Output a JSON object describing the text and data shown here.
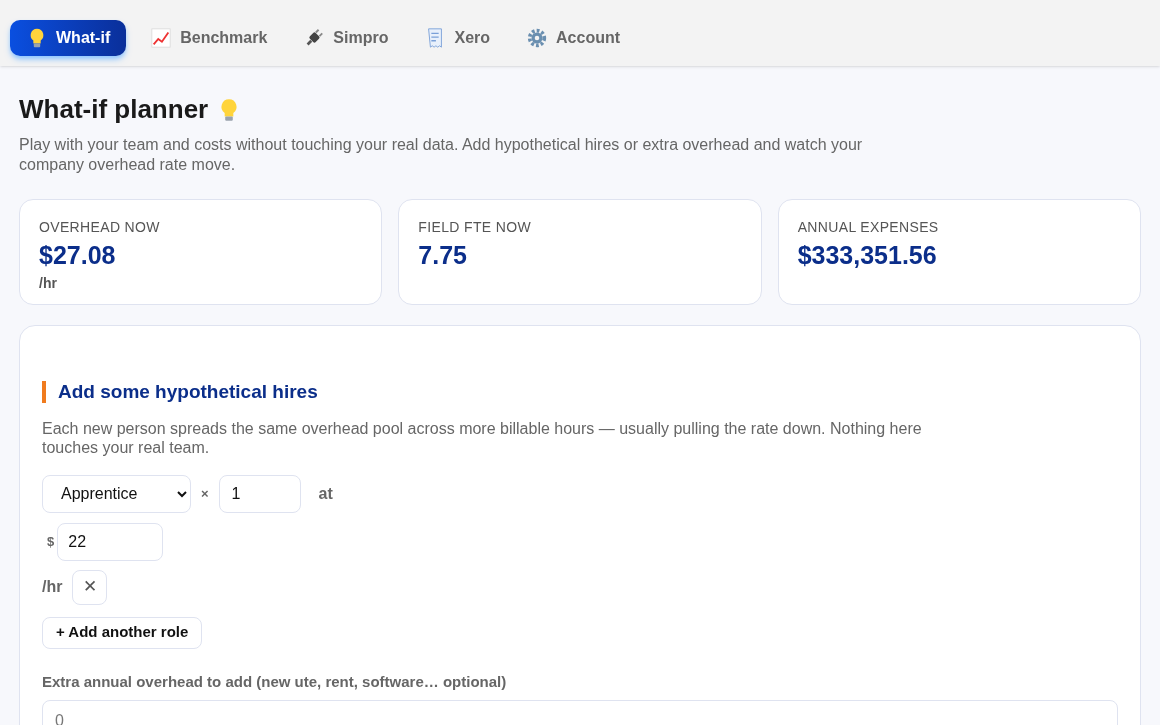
{
  "nav": [
    {
      "label": "What-if",
      "selected": true
    },
    {
      "label": "Benchmark",
      "selected": false
    },
    {
      "label": "Simpro",
      "selected": false
    },
    {
      "label": "Xero",
      "selected": false
    },
    {
      "label": "Account",
      "selected": false
    }
  ],
  "title": "What-if planner",
  "description": "Play with your team and costs without touching your real data. Add hypothetical hires or extra overhead and watch your company overhead rate move.",
  "stats": [
    {
      "label": "OVERHEAD NOW",
      "value": "$27.08",
      "unit": "/hr"
    },
    {
      "label": "FIELD FTE NOW",
      "value": "7.75"
    },
    {
      "label": "ANNUAL EXPENSES",
      "value": "$333,351.56"
    }
  ],
  "hires": {
    "heading": "Add some hypothetical hires",
    "note": "Each new person spreads the same overhead pool across more billable hours — usually pulling the rate down. Nothing here touches your real team.",
    "rows": [
      {
        "role": "Apprentice",
        "times": "×",
        "count": "1",
        "at": "at",
        "currency": "$",
        "rate": "22",
        "unit": "/hr",
        "remove": "✕"
      }
    ],
    "add_button": "+ Add another role",
    "extra_label": "Extra annual overhead to add (new ute, rent, software… optional)",
    "extra_placeholder": "0"
  }
}
